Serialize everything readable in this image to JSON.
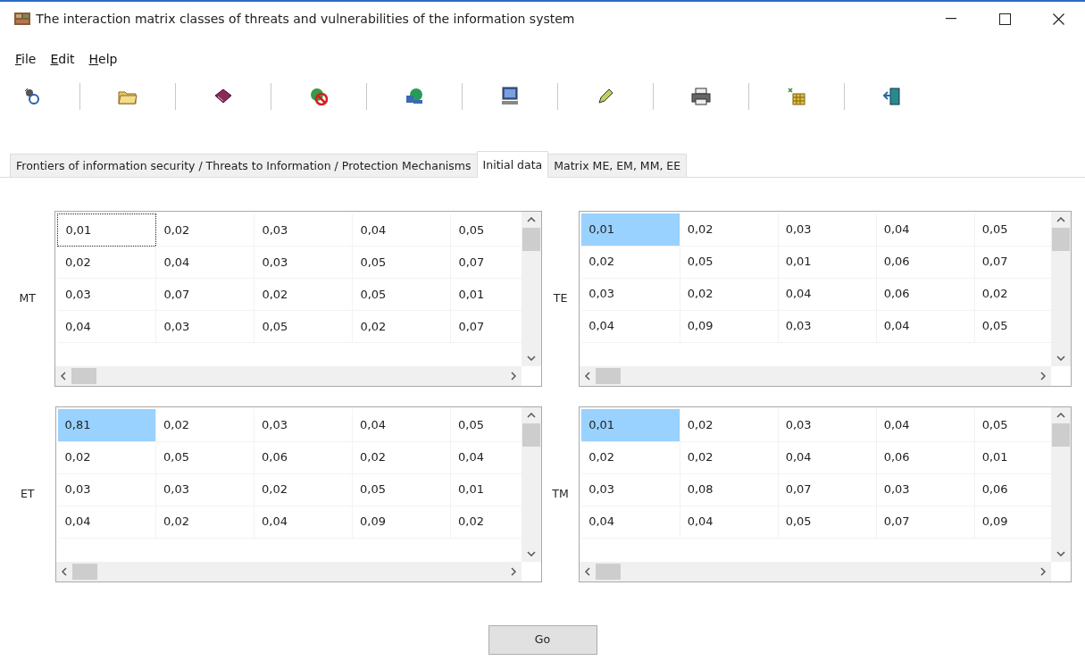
{
  "window": {
    "title": "The interaction matrix classes of threats and vulnerabilities of the information system"
  },
  "menu": [
    {
      "label": "File"
    },
    {
      "label": "Edit"
    },
    {
      "label": "Help"
    }
  ],
  "tabs": [
    {
      "label": "Frontiers of information security / Threats to Information / Protection Mechanisms",
      "selected": false
    },
    {
      "label": "Initial data",
      "selected": true
    },
    {
      "label": "Matrix ME, EM, MM, EE",
      "selected": false
    }
  ],
  "grids": [
    {
      "label": "MT",
      "rows": [
        [
          {
            "text": "0,01",
            "selected": false,
            "focused": true
          },
          {
            "text": "0,02",
            "selected": false,
            "focused": false
          },
          {
            "text": "0,03",
            "selected": false,
            "focused": false
          },
          {
            "text": "0,04",
            "selected": false,
            "focused": false
          },
          {
            "text": "0,05",
            "selected": false,
            "focused": false
          }
        ],
        [
          {
            "text": "0,02",
            "selected": false,
            "focused": false
          },
          {
            "text": "0,04",
            "selected": false,
            "focused": false
          },
          {
            "text": "0,03",
            "selected": false,
            "focused": false
          },
          {
            "text": "0,05",
            "selected": false,
            "focused": false
          },
          {
            "text": "0,07",
            "selected": false,
            "focused": false
          }
        ],
        [
          {
            "text": "0,03",
            "selected": false,
            "focused": false
          },
          {
            "text": "0,07",
            "selected": false,
            "focused": false
          },
          {
            "text": "0,02",
            "selected": false,
            "focused": false
          },
          {
            "text": "0,05",
            "selected": false,
            "focused": false
          },
          {
            "text": "0,01",
            "selected": false,
            "focused": false
          }
        ],
        [
          {
            "text": "0,04",
            "selected": false,
            "focused": false
          },
          {
            "text": "0,03",
            "selected": false,
            "focused": false
          },
          {
            "text": "0,05",
            "selected": false,
            "focused": false
          },
          {
            "text": "0,02",
            "selected": false,
            "focused": false
          },
          {
            "text": "0,07",
            "selected": false,
            "focused": false
          }
        ]
      ]
    },
    {
      "label": "TE",
      "rows": [
        [
          {
            "text": "0,01",
            "selected": true,
            "focused": false
          },
          {
            "text": "0,02",
            "selected": false,
            "focused": false
          },
          {
            "text": "0,03",
            "selected": false,
            "focused": false
          },
          {
            "text": "0,04",
            "selected": false,
            "focused": false
          },
          {
            "text": "0,05",
            "selected": false,
            "focused": false
          }
        ],
        [
          {
            "text": "0,02",
            "selected": false,
            "focused": false
          },
          {
            "text": "0,05",
            "selected": false,
            "focused": false
          },
          {
            "text": "0,01",
            "selected": false,
            "focused": false
          },
          {
            "text": "0,06",
            "selected": false,
            "focused": false
          },
          {
            "text": "0,07",
            "selected": false,
            "focused": false
          }
        ],
        [
          {
            "text": "0,03",
            "selected": false,
            "focused": false
          },
          {
            "text": "0,02",
            "selected": false,
            "focused": false
          },
          {
            "text": "0,04",
            "selected": false,
            "focused": false
          },
          {
            "text": "0,06",
            "selected": false,
            "focused": false
          },
          {
            "text": "0,02",
            "selected": false,
            "focused": false
          }
        ],
        [
          {
            "text": "0,04",
            "selected": false,
            "focused": false
          },
          {
            "text": "0,09",
            "selected": false,
            "focused": false
          },
          {
            "text": "0,03",
            "selected": false,
            "focused": false
          },
          {
            "text": "0,04",
            "selected": false,
            "focused": false
          },
          {
            "text": "0,05",
            "selected": false,
            "focused": false
          }
        ]
      ]
    },
    {
      "label": "ET",
      "rows": [
        [
          {
            "text": "0,81",
            "selected": true,
            "focused": false
          },
          {
            "text": "0,02",
            "selected": false,
            "focused": false
          },
          {
            "text": "0,03",
            "selected": false,
            "focused": false
          },
          {
            "text": "0,04",
            "selected": false,
            "focused": false
          },
          {
            "text": "0,05",
            "selected": false,
            "focused": false
          }
        ],
        [
          {
            "text": "0,02",
            "selected": false,
            "focused": false
          },
          {
            "text": "0,05",
            "selected": false,
            "focused": false
          },
          {
            "text": "0,06",
            "selected": false,
            "focused": false
          },
          {
            "text": "0,02",
            "selected": false,
            "focused": false
          },
          {
            "text": "0,04",
            "selected": false,
            "focused": false
          }
        ],
        [
          {
            "text": "0,03",
            "selected": false,
            "focused": false
          },
          {
            "text": "0,03",
            "selected": false,
            "focused": false
          },
          {
            "text": "0,02",
            "selected": false,
            "focused": false
          },
          {
            "text": "0,05",
            "selected": false,
            "focused": false
          },
          {
            "text": "0,01",
            "selected": false,
            "focused": false
          }
        ],
        [
          {
            "text": "0,04",
            "selected": false,
            "focused": false
          },
          {
            "text": "0,02",
            "selected": false,
            "focused": false
          },
          {
            "text": "0,04",
            "selected": false,
            "focused": false
          },
          {
            "text": "0,09",
            "selected": false,
            "focused": false
          },
          {
            "text": "0,02",
            "selected": false,
            "focused": false
          }
        ]
      ]
    },
    {
      "label": "TM",
      "rows": [
        [
          {
            "text": "0,01",
            "selected": true,
            "focused": false
          },
          {
            "text": "0,02",
            "selected": false,
            "focused": false
          },
          {
            "text": "0,03",
            "selected": false,
            "focused": false
          },
          {
            "text": "0,04",
            "selected": false,
            "focused": false
          },
          {
            "text": "0,05",
            "selected": false,
            "focused": false
          }
        ],
        [
          {
            "text": "0,02",
            "selected": false,
            "focused": false
          },
          {
            "text": "0,02",
            "selected": false,
            "focused": false
          },
          {
            "text": "0,04",
            "selected": false,
            "focused": false
          },
          {
            "text": "0,06",
            "selected": false,
            "focused": false
          },
          {
            "text": "0,01",
            "selected": false,
            "focused": false
          }
        ],
        [
          {
            "text": "0,03",
            "selected": false,
            "focused": false
          },
          {
            "text": "0,08",
            "selected": false,
            "focused": false
          },
          {
            "text": "0,07",
            "selected": false,
            "focused": false
          },
          {
            "text": "0,03",
            "selected": false,
            "focused": false
          },
          {
            "text": "0,06",
            "selected": false,
            "focused": false
          }
        ],
        [
          {
            "text": "0,04",
            "selected": false,
            "focused": false
          },
          {
            "text": "0,04",
            "selected": false,
            "focused": false
          },
          {
            "text": "0,05",
            "selected": false,
            "focused": false
          },
          {
            "text": "0,07",
            "selected": false,
            "focused": false
          },
          {
            "text": "0,09",
            "selected": false,
            "focused": false
          }
        ]
      ]
    }
  ],
  "go_button": {
    "label": "Go"
  }
}
